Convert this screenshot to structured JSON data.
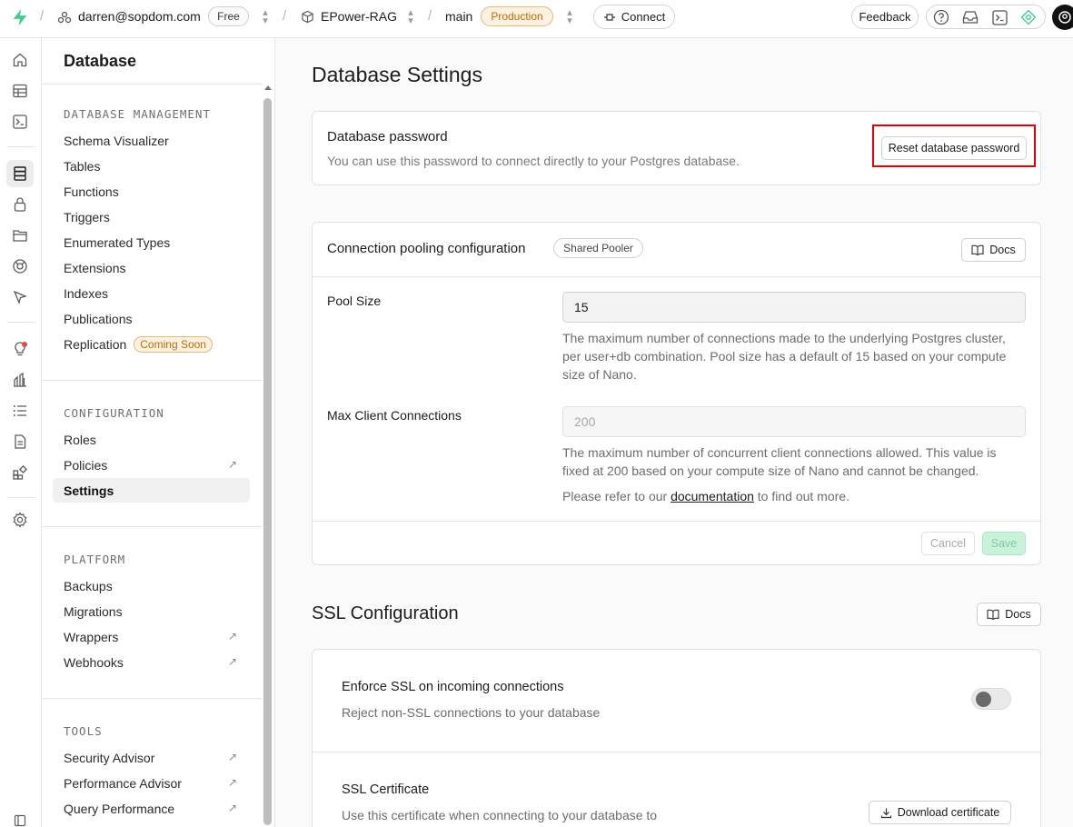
{
  "topbar": {
    "user": "darren@sopdom.com",
    "plan": "Free",
    "project": "EPower-RAG",
    "branch": "main",
    "env": "Production",
    "connect_label": "Connect",
    "feedback_label": "Feedback"
  },
  "sidebar": {
    "title": "Database",
    "sections": {
      "db_management": "DATABASE MANAGEMENT",
      "configuration": "CONFIGURATION",
      "platform": "PLATFORM",
      "tools": "TOOLS"
    },
    "items": {
      "schema_visualizer": "Schema Visualizer",
      "tables": "Tables",
      "functions": "Functions",
      "triggers": "Triggers",
      "enumerated_types": "Enumerated Types",
      "extensions": "Extensions",
      "indexes": "Indexes",
      "publications": "Publications",
      "replication": "Replication",
      "replication_badge": "Coming Soon",
      "roles": "Roles",
      "policies": "Policies",
      "settings": "Settings",
      "backups": "Backups",
      "migrations": "Migrations",
      "wrappers": "Wrappers",
      "webhooks": "Webhooks",
      "security_advisor": "Security Advisor",
      "performance_advisor": "Performance Advisor",
      "query_performance": "Query Performance"
    }
  },
  "main": {
    "title": "Database Settings",
    "password_card": {
      "title": "Database password",
      "desc": "You can use this password to connect directly to your Postgres database.",
      "reset_label": "Reset database password"
    },
    "pooling_card": {
      "title": "Connection pooling configuration",
      "badge": "Shared Pooler",
      "docs_label": "Docs",
      "pool_size_label": "Pool Size",
      "pool_size_value": "15",
      "pool_size_help": "The maximum number of connections made to the underlying Postgres cluster, per user+db combination. Pool size has a default of 15 based on your compute size of Nano.",
      "max_client_label": "Max Client Connections",
      "max_client_value": "200",
      "max_client_help": "The maximum number of concurrent client connections allowed. This value is fixed at 200 based on your compute size of Nano and cannot be changed.",
      "refer_prefix": "Please refer to our",
      "refer_link": "documentation",
      "refer_suffix": "to find out more.",
      "cancel_label": "Cancel",
      "save_label": "Save"
    },
    "ssl": {
      "title": "SSL Configuration",
      "docs_label": "Docs",
      "enforce_title": "Enforce SSL on incoming connections",
      "enforce_desc": "Reject non-SSL connections to your database",
      "enforce_enabled": false,
      "cert_title": "SSL Certificate",
      "cert_desc": "Use this certificate when connecting to your database to",
      "download_label": "Download certificate"
    }
  },
  "colors": {
    "brand": "#3ecf8e",
    "production": "#c06c06",
    "highlight": "#e00000",
    "save_bg": "#a9ecc7"
  }
}
